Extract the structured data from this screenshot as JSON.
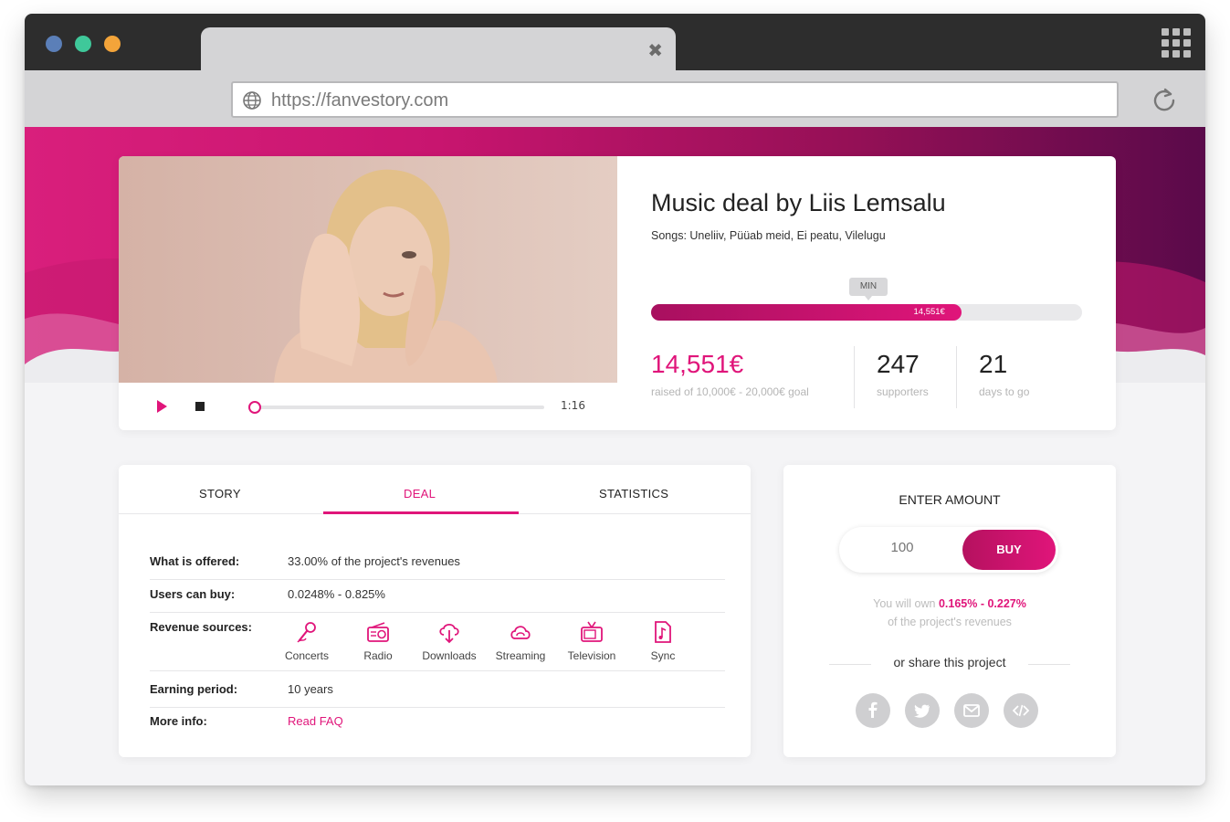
{
  "browser": {
    "url": "https://fanvestory.com",
    "tab_close_icon": "close-icon",
    "menu_icon": "grid-menu-icon"
  },
  "colors": {
    "accent": "#e0157a",
    "hero_start": "#d91f7c",
    "hero_end": "#5a0a4a"
  },
  "project": {
    "title": "Music deal by Liis Lemsalu",
    "songs": "Songs: Uneliiv, Püüab meid, Ei peatu, Vilelugu",
    "min_marker": "MIN",
    "progress_fraction": 0.72,
    "progress_label": "14,551€",
    "raised": "14,551€",
    "raised_sub": "raised of 10,000€ - 20,000€ goal",
    "supporters": "247",
    "supporters_label": "supporters",
    "days": "21",
    "days_label": "days to go"
  },
  "player": {
    "time": "1:16",
    "play_icon": "play-icon",
    "stop_icon": "stop-icon"
  },
  "deal": {
    "tabs": [
      "STORY",
      "DEAL",
      "STATISTICS"
    ],
    "active_tab": "DEAL",
    "offered_label": "What is offered:",
    "offered_value": "33.00% of the project's revenues",
    "buy_label": "Users can buy:",
    "buy_value": "0.0248% - 0.825%",
    "sources_label": "Revenue sources:",
    "sources": [
      {
        "label": "Concerts",
        "icon": "microphone-icon"
      },
      {
        "label": "Radio",
        "icon": "radio-icon"
      },
      {
        "label": "Downloads",
        "icon": "cloud-download-icon"
      },
      {
        "label": "Streaming",
        "icon": "cloud-streaming-icon"
      },
      {
        "label": "Television",
        "icon": "tv-icon"
      },
      {
        "label": "Sync",
        "icon": "music-file-icon"
      }
    ],
    "period_label": "Earning period:",
    "period_value": "10 years",
    "info_label": "More info:",
    "info_link": "Read FAQ"
  },
  "purchase": {
    "heading": "ENTER AMOUNT",
    "amount_placeholder": "100",
    "buy_label": "BUY",
    "own_prefix": "You will own",
    "own_range": "0.165% - 0.227%",
    "own_suffix": "of the project's revenues",
    "share_text": "or share this project",
    "share_icons": [
      "facebook-icon",
      "twitter-icon",
      "email-icon",
      "embed-code-icon"
    ]
  }
}
